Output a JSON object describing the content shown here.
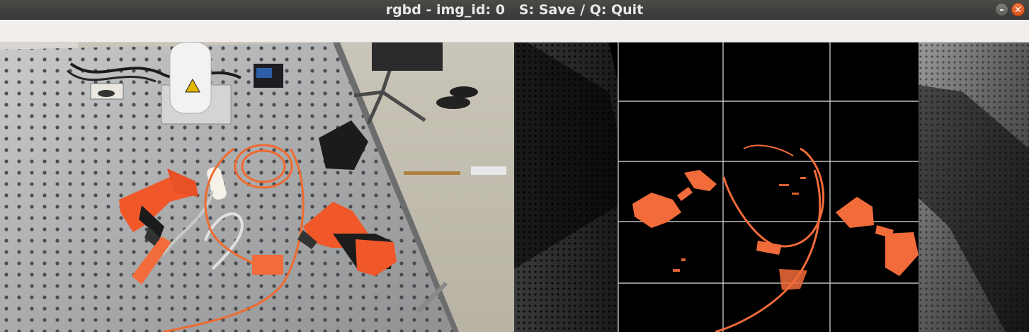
{
  "window": {
    "title": "rgbd - img_id: 0   S: Save / Q: Quit",
    "minimize_glyph": "–",
    "close_glyph": "✕"
  },
  "colors": {
    "titlebar": "#3c3b37",
    "toolbar": "#f1eeeb",
    "close_button": "#e95420",
    "highlight": "#f26b3a",
    "grid_line": "#bfbfbf"
  },
  "panels": {
    "rgb": {
      "description_icon": "rgb-image"
    },
    "depth": {
      "description_icon": "depth-image"
    }
  }
}
